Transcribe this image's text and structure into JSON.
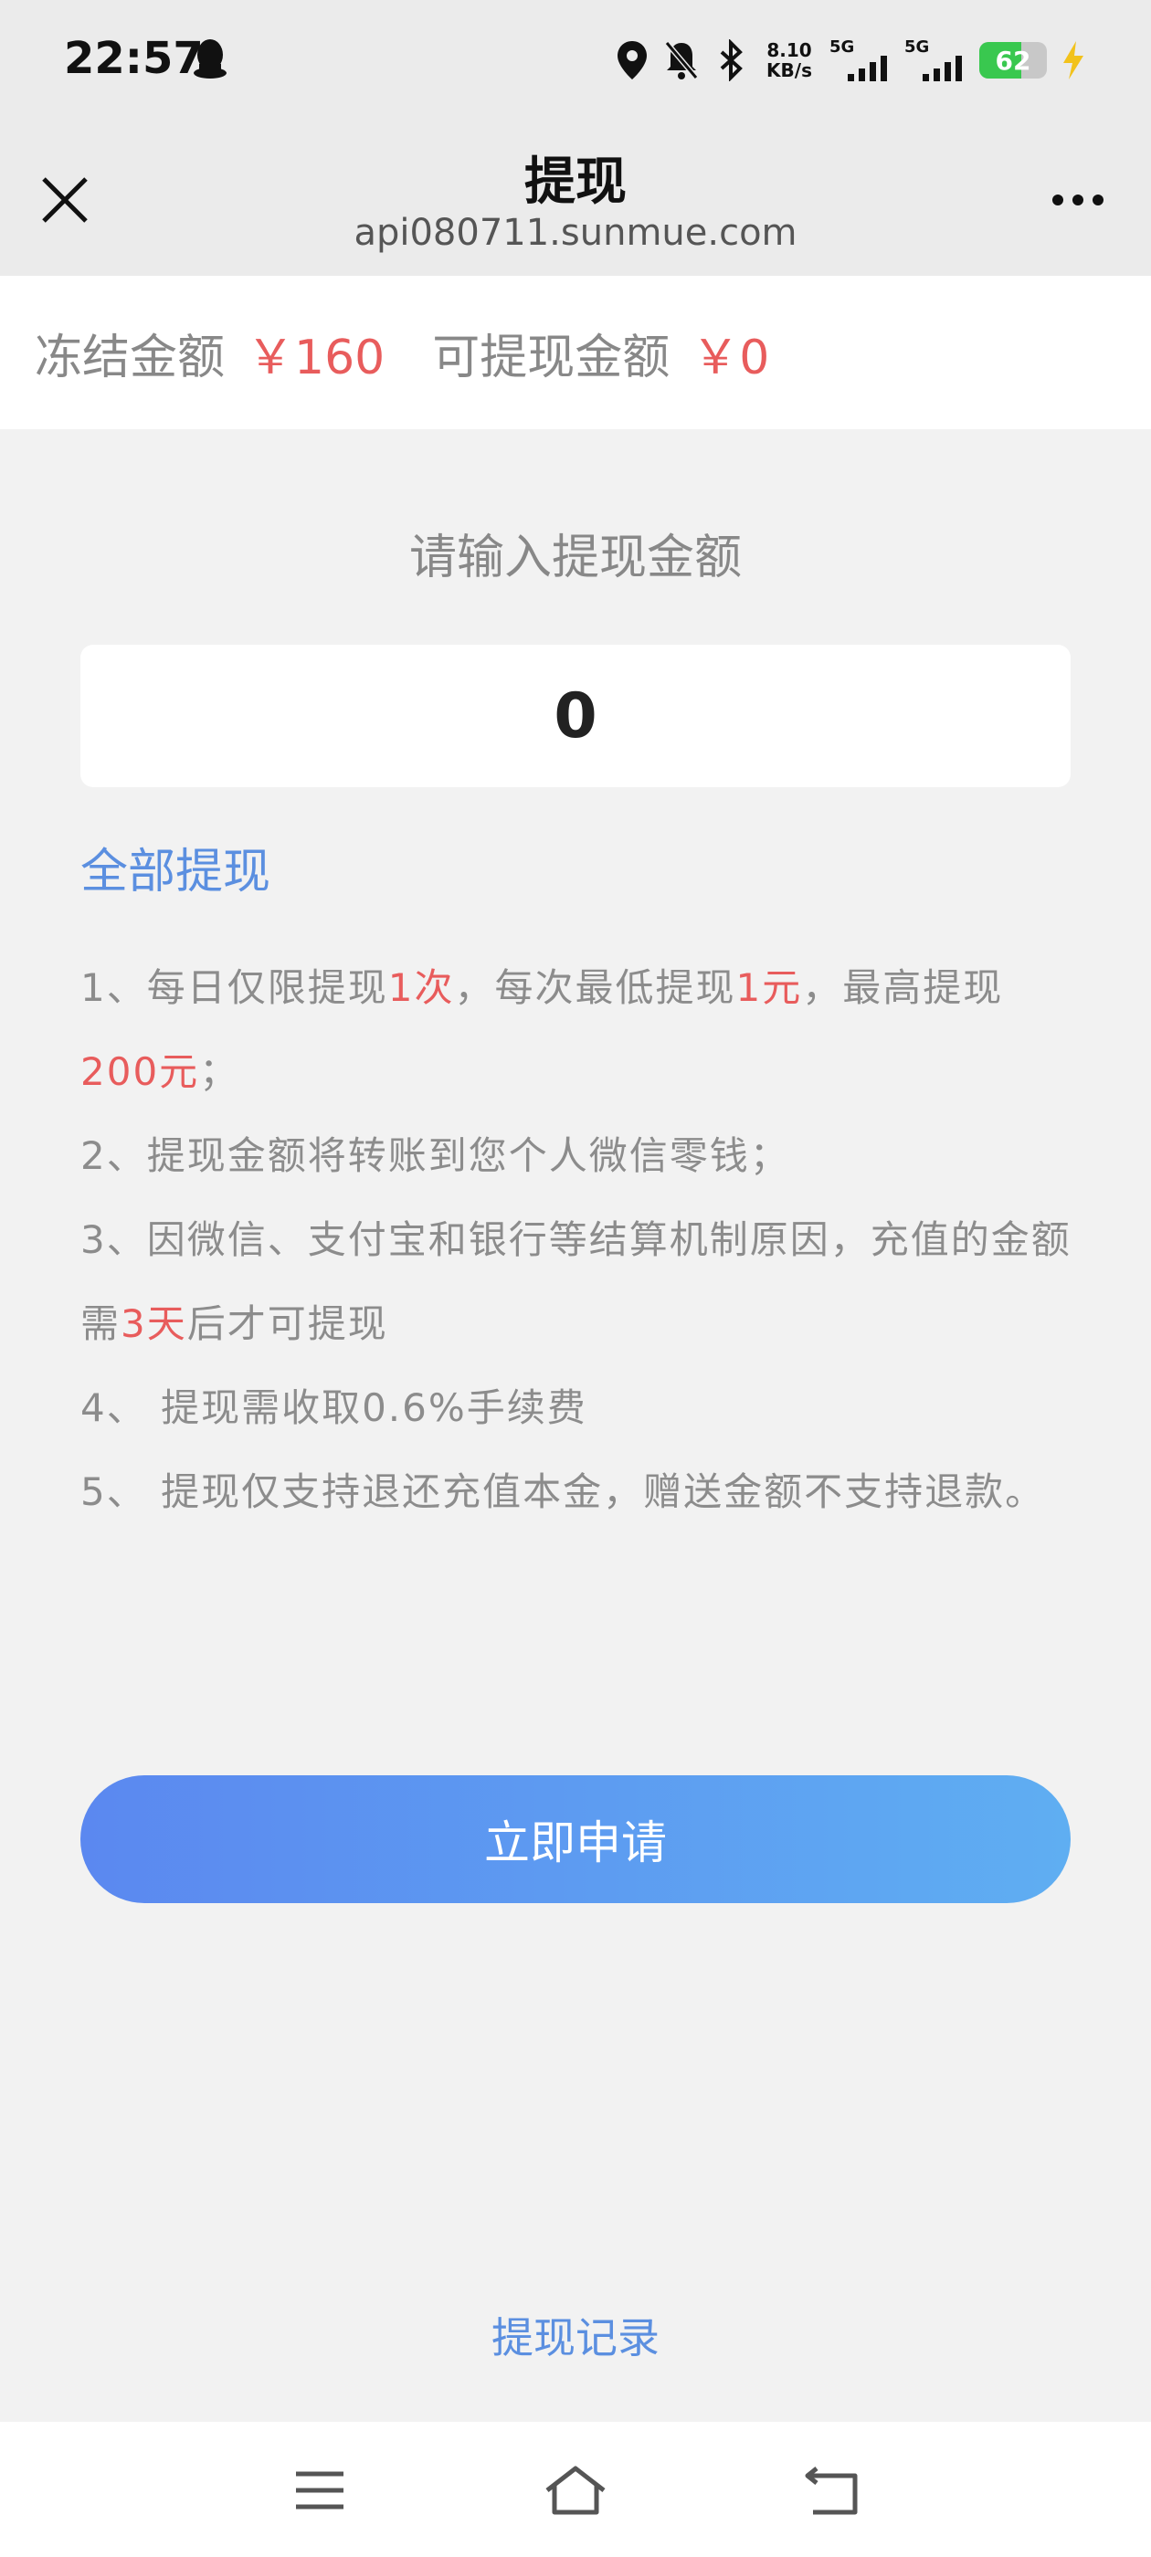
{
  "status_bar": {
    "time": "22:57",
    "net_speed_value": "8.10",
    "net_speed_unit": "KB/s",
    "signal1_label": "5G",
    "signal2_label": "5G",
    "battery_level": "62",
    "icons": [
      "qq-icon",
      "location-icon",
      "bell-muted-icon",
      "bluetooth-icon",
      "signal-icon",
      "battery-icon",
      "charging-bolt-icon"
    ]
  },
  "header": {
    "title": "提现",
    "url": "api080711.sunmue.com",
    "close_icon": "close-icon",
    "more_icon": "more-dots-icon"
  },
  "balance": {
    "frozen_label": "冻结金额",
    "frozen_amount": "￥160",
    "available_label": "可提现金额",
    "available_amount": "￥0"
  },
  "form": {
    "prompt": "请输入提现金额",
    "amount_value": "0",
    "withdraw_all": "全部提现"
  },
  "rules": {
    "r1_a": "1、每日仅限提现",
    "r1_b": "1次",
    "r1_c": "，每次最低提现",
    "r1_d": "1元",
    "r1_e": "，最高提现",
    "r1_f": "200元",
    "r1_g": "；",
    "r2": "2、提现金额将转账到您个人微信零钱；",
    "r3_a": "3、因微信、支付宝和银行等结算机制原因，充值的金额需",
    "r3_b": "3天",
    "r3_c": "后才可提现",
    "r4": "4、 提现需收取0.6%手续费",
    "r5": "5、 提现仅支持退还充值本金，赠送金额不支持退款。"
  },
  "actions": {
    "apply": "立即申请",
    "records": "提现记录"
  },
  "nav_bar": {
    "icons": [
      "menu-icon",
      "home-icon",
      "back-icon"
    ]
  },
  "colors": {
    "accent_blue": "#5b8fe0",
    "highlight_red": "#e85c5c",
    "button_gradient_start": "#5b88f0",
    "button_gradient_end": "#5faef2",
    "battery_green": "#39c84f"
  }
}
